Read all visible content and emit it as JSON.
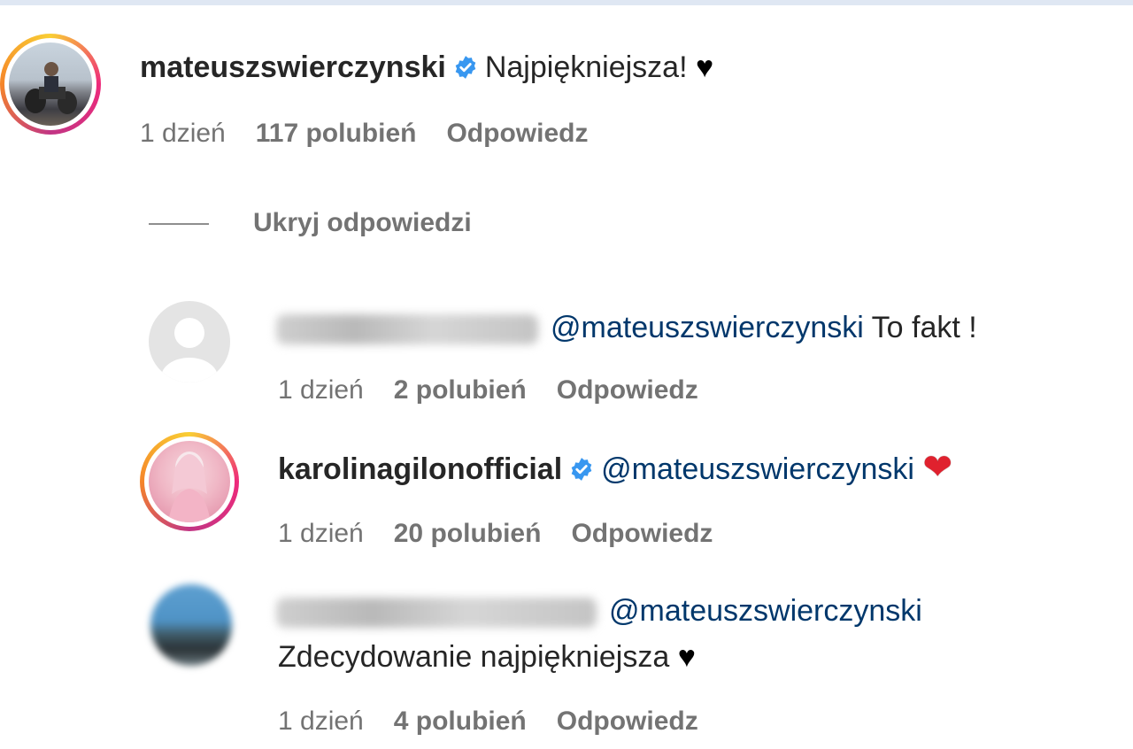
{
  "comments": {
    "main": {
      "username": "mateuszswierczynski",
      "text": "Najpiękniejsza!",
      "heart": "♥",
      "time": "1 dzień",
      "likes": "117 polubień",
      "reply": "Odpowiedz"
    },
    "hide_replies": "Ukryj odpowiedzi",
    "replies": [
      {
        "mention": "@mateuszswierczynski",
        "text": "To fakt !",
        "time": "1 dzień",
        "likes": "2 polubień",
        "reply": "Odpowiedz"
      },
      {
        "username": "karolinagilonofficial",
        "mention": "@mateuszswierczynski",
        "heart": "❤",
        "time": "1 dzień",
        "likes": "20 polubień",
        "reply": "Odpowiedz"
      },
      {
        "mention": "@mateuszswierczynski",
        "text": "Zdecydowanie najpiękniejsza",
        "heart": "♥",
        "time": "1 dzień",
        "likes": "4 polubień",
        "reply": "Odpowiedz"
      }
    ]
  },
  "colors": {
    "mention": "#00376b",
    "meta": "#737373",
    "verified": "#3897f0",
    "heart_red": "#e0212e"
  },
  "icons": [
    "verified-badge-icon",
    "heart-icon",
    "default-avatar-icon"
  ]
}
